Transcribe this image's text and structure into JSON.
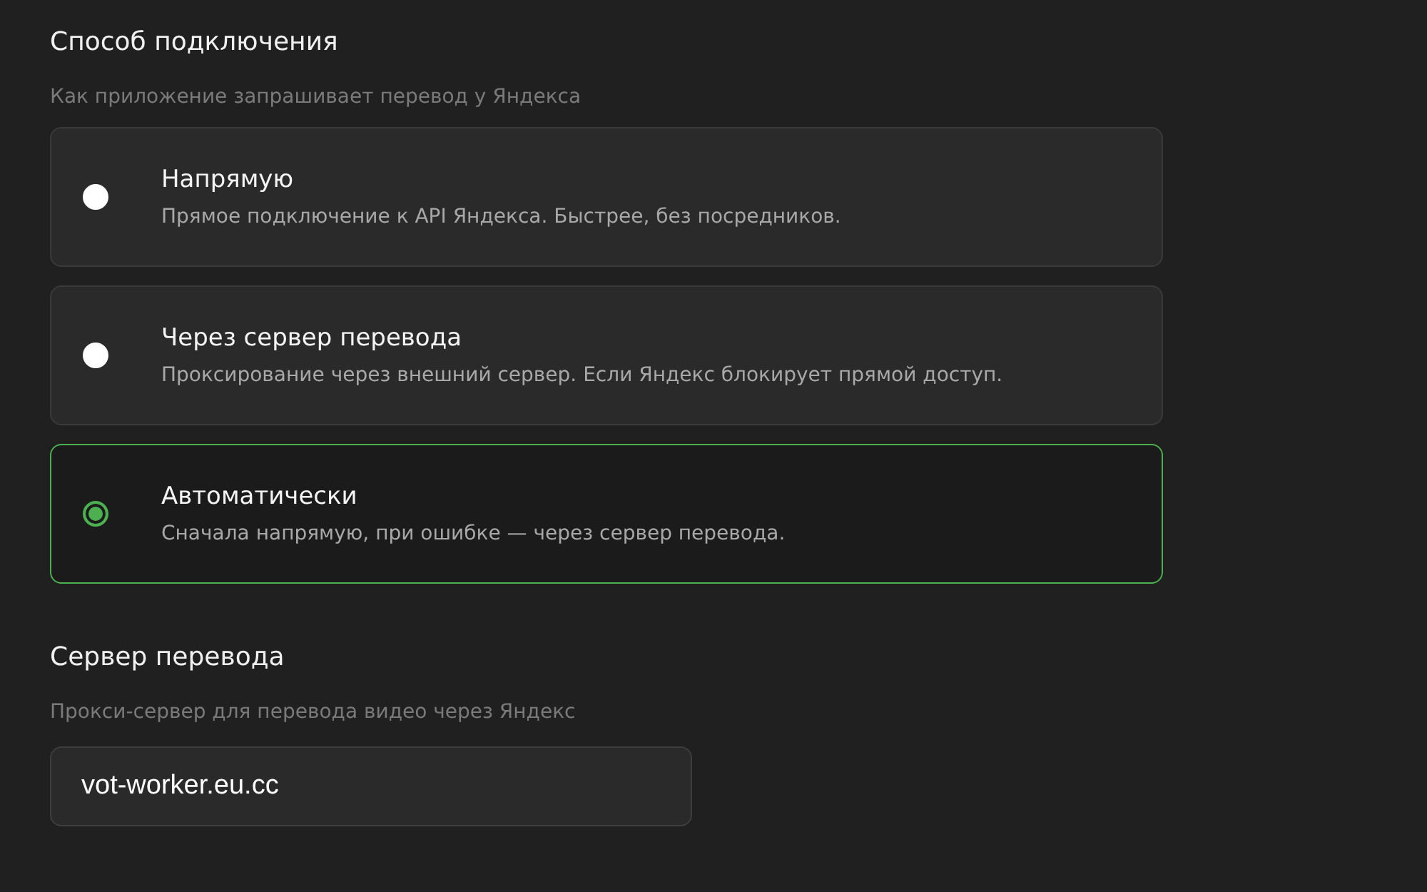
{
  "connection": {
    "title": "Способ подключения",
    "description": "Как приложение запрашивает перевод у Яндекса",
    "options": [
      {
        "label": "Напрямую",
        "description": "Прямое подключение к API Яндекса. Быстрее, без посредников.",
        "selected": false
      },
      {
        "label": "Через сервер перевода",
        "description": "Проксирование через внешний сервер. Если Яндекс блокирует прямой доступ.",
        "selected": false
      },
      {
        "label": "Автоматически",
        "description": "Сначала напрямую, при ошибке — через сервер перевода.",
        "selected": true
      }
    ]
  },
  "server": {
    "title": "Сервер перевода",
    "description": "Прокси-сервер для перевода видео через Яндекс",
    "value": "vot-worker.eu.cc"
  }
}
